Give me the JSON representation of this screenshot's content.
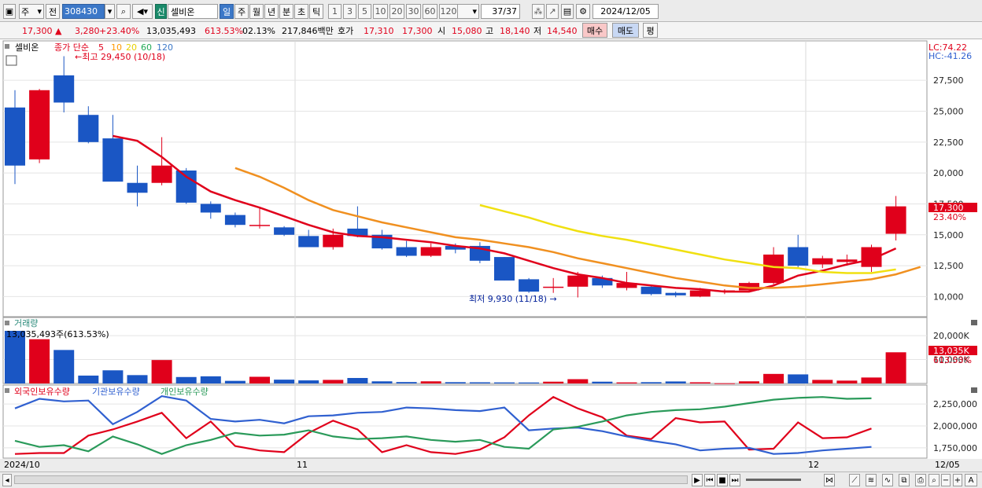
{
  "toolbar": {
    "period_label": "주",
    "prev_label": "전",
    "stock_code": "308430",
    "badge_new": "신",
    "stock_name": "셀비온",
    "period_buttons": [
      "일",
      "주",
      "월",
      "년",
      "분",
      "초",
      "틱"
    ],
    "interval_buttons": [
      "1",
      "3",
      "5",
      "10",
      "20",
      "30",
      "60",
      "120"
    ],
    "page_count": "37",
    "page_total": "/37",
    "date": "2024/12/05"
  },
  "quote": {
    "price": "17,300",
    "change": "3,280",
    "change_pct": "+23.40%",
    "volume": "13,035,493",
    "volume_pct": "613.53%",
    "turnover": "02.13%",
    "amount": "217,846백만",
    "bid_label": "호가",
    "bid": "17,310",
    "ask": "17,300",
    "open_label": "시",
    "open": "15,080",
    "high_label": "고",
    "high": "18,140",
    "low_label": "저",
    "low": "14,540",
    "buy_label": "매수",
    "sell_label": "매도",
    "eval_label": "평"
  },
  "price_pane": {
    "legend_name": "셀비온",
    "legend_ma_title": "종가 단순",
    "ma_periods": [
      "5",
      "10",
      "20",
      "60",
      "120"
    ],
    "ma_colors": [
      "#e0001b",
      "#ff9900",
      "#e8d000",
      "#22aa55",
      "#3c78c8"
    ],
    "max_note": "최고 29,450 (10/18)",
    "min_note": "최저 9,930 (11/18)",
    "lc_label": "LC:74.22",
    "hc_label": "HC:-41.26",
    "last_price_label": "17,300",
    "last_pct_label": "23.40%"
  },
  "volume_pane": {
    "title": "거래량",
    "info": "13,035,493주(613.53%)",
    "last_label": "13,035K",
    "last_pct_label": "613.53%"
  },
  "holdings_pane": {
    "legend": [
      "외국인보유수량",
      "기관보유수량",
      "개인보유수량"
    ],
    "colors": [
      "#e0001b",
      "#3060d0",
      "#2a9a5a"
    ]
  },
  "x_labels": [
    "2024/10",
    "11",
    "12",
    "12/05"
  ],
  "colors": {
    "up": "#e0001b",
    "down": "#1a56c4",
    "ma5": "#e0001b",
    "ma10": "#f09020",
    "ma20": "#f0e010"
  },
  "chart_data": [
    {
      "type": "candlestick",
      "title": "셀비온",
      "ylim": [
        8500,
        30500
      ],
      "yticks": [
        10000,
        12500,
        15000,
        17500,
        20000,
        22500,
        25000,
        27500
      ],
      "candles": [
        {
          "o": 25300,
          "h": 26700,
          "l": 19100,
          "c": 20600
        },
        {
          "o": 21100,
          "h": 26800,
          "l": 20800,
          "c": 26700
        },
        {
          "o": 27900,
          "h": 29450,
          "l": 24900,
          "c": 25700
        },
        {
          "o": 24700,
          "h": 25400,
          "l": 22400,
          "c": 22500
        },
        {
          "o": 22800,
          "h": 24700,
          "l": 22000,
          "c": 19300
        },
        {
          "o": 19200,
          "h": 20600,
          "l": 17300,
          "c": 18400
        },
        {
          "o": 19200,
          "h": 22900,
          "l": 19000,
          "c": 20600
        },
        {
          "o": 20200,
          "h": 20400,
          "l": 17500,
          "c": 17600
        },
        {
          "o": 17500,
          "h": 17700,
          "l": 16300,
          "c": 16800
        },
        {
          "o": 16600,
          "h": 16800,
          "l": 15600,
          "c": 15800
        },
        {
          "o": 15800,
          "h": 17200,
          "l": 15500,
          "c": 15800
        },
        {
          "o": 15600,
          "h": 15700,
          "l": 14900,
          "c": 15000
        },
        {
          "o": 14900,
          "h": 15400,
          "l": 14000,
          "c": 14000
        },
        {
          "o": 14000,
          "h": 15500,
          "l": 13800,
          "c": 15000
        },
        {
          "o": 15500,
          "h": 17300,
          "l": 14800,
          "c": 14900
        },
        {
          "o": 15000,
          "h": 15400,
          "l": 13800,
          "c": 13900
        },
        {
          "o": 14000,
          "h": 14500,
          "l": 13200,
          "c": 13300
        },
        {
          "o": 13300,
          "h": 14300,
          "l": 13200,
          "c": 14000
        },
        {
          "o": 14100,
          "h": 14300,
          "l": 13500,
          "c": 13800
        },
        {
          "o": 14100,
          "h": 14400,
          "l": 12700,
          "c": 12900
        },
        {
          "o": 13200,
          "h": 13200,
          "l": 11300,
          "c": 11300
        },
        {
          "o": 11400,
          "h": 11500,
          "l": 10300,
          "c": 10400
        },
        {
          "o": 10800,
          "h": 11500,
          "l": 10300,
          "c": 10800
        },
        {
          "o": 10800,
          "h": 12000,
          "l": 9930,
          "c": 11700
        },
        {
          "o": 11500,
          "h": 11700,
          "l": 10700,
          "c": 10900
        },
        {
          "o": 10700,
          "h": 12000,
          "l": 10500,
          "c": 11100
        },
        {
          "o": 10800,
          "h": 10900,
          "l": 10100,
          "c": 10200
        },
        {
          "o": 10300,
          "h": 10400,
          "l": 9950,
          "c": 10100
        },
        {
          "o": 10000,
          "h": 10700,
          "l": 9950,
          "c": 10500
        },
        {
          "o": 10400,
          "h": 10600,
          "l": 10200,
          "c": 10500
        },
        {
          "o": 10500,
          "h": 11200,
          "l": 10400,
          "c": 11100
        },
        {
          "o": 11100,
          "h": 14000,
          "l": 11000,
          "c": 13400
        },
        {
          "o": 14000,
          "h": 15000,
          "l": 12300,
          "c": 12500
        },
        {
          "o": 12600,
          "h": 13300,
          "l": 12300,
          "c": 13100
        },
        {
          "o": 12800,
          "h": 13400,
          "l": 12500,
          "c": 13000
        },
        {
          "o": 12400,
          "h": 14200,
          "l": 12000,
          "c": 14000
        },
        {
          "o": 15080,
          "h": 18140,
          "l": 14540,
          "c": 17300
        }
      ],
      "ma5": [
        null,
        null,
        null,
        null,
        23000,
        22600,
        21300,
        19700,
        18500,
        17800,
        17200,
        16500,
        15800,
        15200,
        14900,
        14800,
        14600,
        14400,
        14100,
        13900,
        13500,
        12900,
        12300,
        11800,
        11500,
        11100,
        10900,
        10700,
        10600,
        10400,
        10400,
        10900,
        11700,
        12100,
        12600,
        13000,
        13900
      ],
      "ma10": [
        null,
        null,
        null,
        null,
        null,
        null,
        null,
        null,
        null,
        20400,
        19700,
        18800,
        17800,
        17000,
        16500,
        16000,
        15600,
        15200,
        14800,
        14600,
        14300,
        14000,
        13600,
        13100,
        12700,
        12300,
        11900,
        11500,
        11200,
        10900,
        10700,
        10700,
        10800,
        11000,
        11200,
        11400,
        11800,
        12400
      ],
      "ma20": [
        null,
        null,
        null,
        null,
        null,
        null,
        null,
        null,
        null,
        null,
        null,
        null,
        null,
        null,
        null,
        null,
        null,
        null,
        null,
        17400,
        16900,
        16400,
        15800,
        15300,
        14900,
        14600,
        14200,
        13800,
        13400,
        13000,
        12700,
        12400,
        12300,
        12000,
        11900,
        11900,
        12200
      ],
      "volume_ylim": [
        0,
        22000000
      ],
      "volume_ticks": [
        10000000,
        20000000
      ],
      "volume": [
        22000000,
        18500000,
        14000000,
        3300000,
        5500000,
        3500000,
        9800000,
        2700000,
        3000000,
        1100000,
        2800000,
        1600000,
        1300000,
        1500000,
        2300000,
        900000,
        600000,
        900000,
        550000,
        500000,
        450000,
        420000,
        750000,
        1800000,
        750000,
        450000,
        550000,
        850000,
        500000,
        100000,
        900000,
        4000000,
        3800000,
        1500000,
        1200000,
        2500000,
        13035493
      ],
      "holdings_ylim": [
        1650000,
        2350000
      ],
      "holdings_ticks": [
        1750000,
        2000000,
        2250000
      ],
      "holdings": [
        {
          "name": "외국인보유수량",
          "values": [
            1680000,
            1690000,
            1690000,
            1890000,
            1960000,
            2050000,
            2150000,
            1860000,
            2050000,
            1770000,
            1720000,
            1700000,
            1920000,
            2060000,
            1960000,
            1700000,
            1780000,
            1700000,
            1680000,
            1730000,
            1870000,
            2120000,
            2330000,
            2200000,
            2100000,
            1890000,
            1850000,
            2090000,
            2040000,
            2050000,
            1730000,
            1740000,
            2040000,
            1860000,
            1870000,
            1970000
          ]
        },
        {
          "name": "기관보유수량",
          "values": [
            2200000,
            2310000,
            2280000,
            2290000,
            2020000,
            2160000,
            2340000,
            2290000,
            2080000,
            2050000,
            2070000,
            2030000,
            2110000,
            2120000,
            2150000,
            2160000,
            2210000,
            2200000,
            2180000,
            2170000,
            2210000,
            1950000,
            1970000,
            1980000,
            1940000,
            1880000,
            1830000,
            1790000,
            1720000,
            1740000,
            1750000,
            1680000,
            1690000,
            1720000,
            1740000,
            1760000
          ]
        },
        {
          "name": "개인보유수량",
          "values": [
            1830000,
            1760000,
            1780000,
            1710000,
            1880000,
            1790000,
            1680000,
            1780000,
            1840000,
            1920000,
            1890000,
            1900000,
            1950000,
            1880000,
            1850000,
            1860000,
            1880000,
            1840000,
            1820000,
            1840000,
            1760000,
            1740000,
            1960000,
            1990000,
            2050000,
            2120000,
            2160000,
            2180000,
            2190000,
            2220000,
            2260000,
            2300000,
            2320000,
            2330000,
            2310000,
            2315000
          ]
        }
      ]
    }
  ]
}
